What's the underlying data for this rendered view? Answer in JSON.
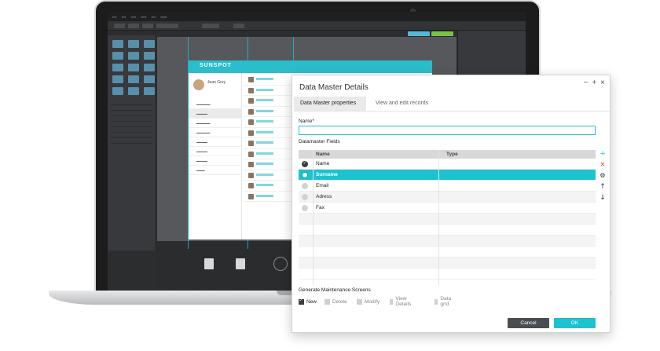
{
  "colors": {
    "accent": "#1cc3cf",
    "dark_button": "#4a4d52",
    "ide_bg": "#2b2d2f"
  },
  "mockup": {
    "logo": "SUNSPOT",
    "user_name": "Jean Grey"
  },
  "dialog": {
    "title": "Data Master Details",
    "controls": [
      "−",
      "+",
      "×"
    ],
    "tabs": [
      "Data Master properties",
      "View and edit records"
    ],
    "name_label": "Name*",
    "name_value": "",
    "fields_label": "Datamaster Fields",
    "columns": [
      "Name",
      "Type"
    ],
    "fields": [
      {
        "name": "Name",
        "type": "",
        "marker": "checked"
      },
      {
        "name": "Surname",
        "type": "",
        "marker": "selected"
      },
      {
        "name": "Email",
        "type": "",
        "marker": "none"
      },
      {
        "name": "Adress",
        "type": "",
        "marker": "none"
      },
      {
        "name": "Fax",
        "type": "",
        "marker": "none"
      }
    ],
    "tools": [
      "+",
      "×",
      "⚙",
      "↑",
      "↓"
    ],
    "maintenance_label": "Generate Maintenance Screens",
    "options": [
      {
        "label": "New",
        "checked": true
      },
      {
        "label": "Delete",
        "checked": false
      },
      {
        "label": "Modify",
        "checked": false
      },
      {
        "label": "View Details",
        "checked": false
      },
      {
        "label": "Data grid",
        "checked": false
      }
    ],
    "cancel_label": "Cancel",
    "ok_label": "OK"
  }
}
